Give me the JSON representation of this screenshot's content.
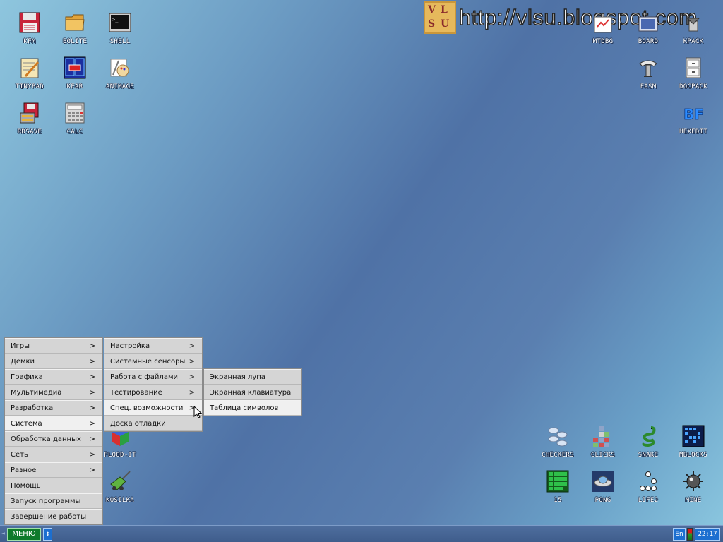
{
  "watermark": {
    "logo_letters": [
      "V",
      "L",
      "S",
      "U"
    ],
    "text": "http://vlsu.blogspot.com"
  },
  "desktop_icons": {
    "kfm": "KFM",
    "eolite": "EOLITE",
    "shell": "SHELL",
    "tinypad": "TINYPAD",
    "kfar": "KFAR",
    "animage": "ANIMAGE",
    "rdsave": "RDSAVE",
    "calc": "CALC",
    "mtdbg": "MTDBG",
    "board": "BOARD",
    "kpack": "KPACK",
    "fasm": "FASM",
    "docpack": "DOCPACK",
    "hexedit": "HEXEDIT",
    "hexedit_glyph": "BF",
    "floodit": "FLOOD-IT",
    "kosilka": "KOSILKA",
    "checkers": "CHECKERS",
    "clicks": "CLICKS",
    "snake": "SNAKE",
    "mblocks": "MBLOCKS",
    "fifteen": "15",
    "pong": "PONG",
    "life2": "LIFE2",
    "mine": "MINE"
  },
  "main_menu": {
    "arrow": ">",
    "items": [
      "Игры",
      "Демки",
      "Графика",
      "Мультимедиа",
      "Разработка",
      "Система",
      "Обработка данных",
      "Сеть",
      "Разное",
      "Помощь",
      "Запуск программы",
      "Завершение работы"
    ]
  },
  "system_menu": {
    "items": [
      "Настройка",
      "Системные сенсоры",
      "Работа с файлами",
      "Тестирование",
      "Спец. возможности",
      "Доска отладки"
    ]
  },
  "accessibility_menu": {
    "items": [
      "Экранная лупа",
      "Экранная клавиатура",
      "Таблица символов"
    ]
  },
  "taskbar": {
    "menu_label": "МЕНЮ",
    "switch_glyph": "↕",
    "language": "En",
    "clock": "22:17",
    "left_arrow": "◄"
  },
  "colors": {
    "menu_button": "#0e7a2b",
    "taskbar": "#4e6e9e",
    "tray_blue": "#1c6fd0"
  }
}
